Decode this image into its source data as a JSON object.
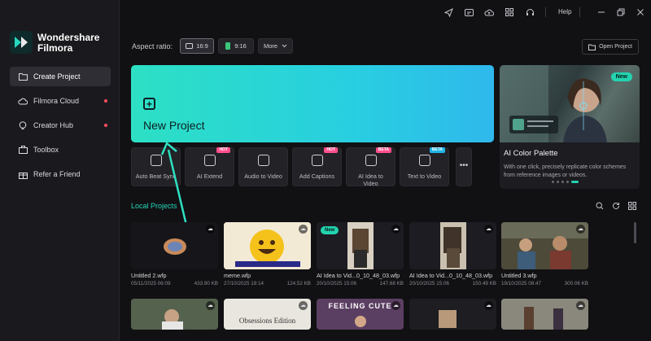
{
  "brand": {
    "line1": "Wondershare",
    "line2": "Filmora"
  },
  "sidebar": {
    "items": [
      {
        "label": "Create Project",
        "icon": "folder-icon",
        "active": true,
        "dot": false
      },
      {
        "label": "Filmora Cloud",
        "icon": "cloud-icon",
        "active": false,
        "dot": true
      },
      {
        "label": "Creator Hub",
        "icon": "bulb-icon",
        "active": false,
        "dot": true
      },
      {
        "label": "Toolbox",
        "icon": "toolbox-icon",
        "active": false,
        "dot": false
      },
      {
        "label": "Refer a Friend",
        "icon": "gift-icon",
        "active": false,
        "dot": false
      }
    ]
  },
  "topbar": {
    "icons": [
      "send-icon",
      "subtitle-icon",
      "cloud-upload-icon",
      "grid-icon",
      "headset-icon"
    ],
    "help": "Help"
  },
  "aspect": {
    "label": "Aspect ratio:",
    "options": [
      "16:9",
      "9:16"
    ],
    "more": "More",
    "selected": "16:9"
  },
  "open_project": "Open Project",
  "new_project": {
    "label": "New Project"
  },
  "tiles": [
    {
      "label": "Auto Beat Sync",
      "badge": ""
    },
    {
      "label": "AI Extend",
      "badge": "HOT"
    },
    {
      "label": "Audio to Video",
      "badge": ""
    },
    {
      "label": "Add Captions",
      "badge": "HOT"
    },
    {
      "label": "AI Idea to Video",
      "badge": "BETA"
    },
    {
      "label": "Text to Video",
      "badge": "BETA"
    }
  ],
  "more_tile": "•••",
  "promo": {
    "badge": "New",
    "title": "AI Color Palette",
    "description": "With one click, precisely replicate color schemes from reference images or videos.",
    "slides": 5,
    "active_slide": 5
  },
  "local_projects": {
    "title": "Local Projects",
    "cards": [
      {
        "name": "Untitled 2.wfp",
        "date": "05/11/2025 06:09",
        "size": "433.90 KB",
        "new": false
      },
      {
        "name": "meme.wfp",
        "date": "27/10/2025 19:14",
        "size": "124.52 KB",
        "new": false
      },
      {
        "name": "AI Idea to Vid...0_10_48_03.wfp",
        "date": "20/10/2025 15:06",
        "size": "147.68 KB",
        "new": true
      },
      {
        "name": "AI Idea to Vid...0_10_48_03.wfp",
        "date": "20/10/2025 15:06",
        "size": "150.49 KB",
        "new": false
      },
      {
        "name": "Untitled 3.wfp",
        "date": "19/10/2025 08:47",
        "size": "300.06 KB",
        "new": false
      }
    ],
    "row2_texts": [
      "",
      "Obsessions Edition",
      "FEELING CUTE",
      "",
      ""
    ]
  },
  "colors": {
    "accent": "#22d7b7",
    "hot_badge": "#ff4f8b",
    "beta_badge": "#1fb6e6"
  }
}
